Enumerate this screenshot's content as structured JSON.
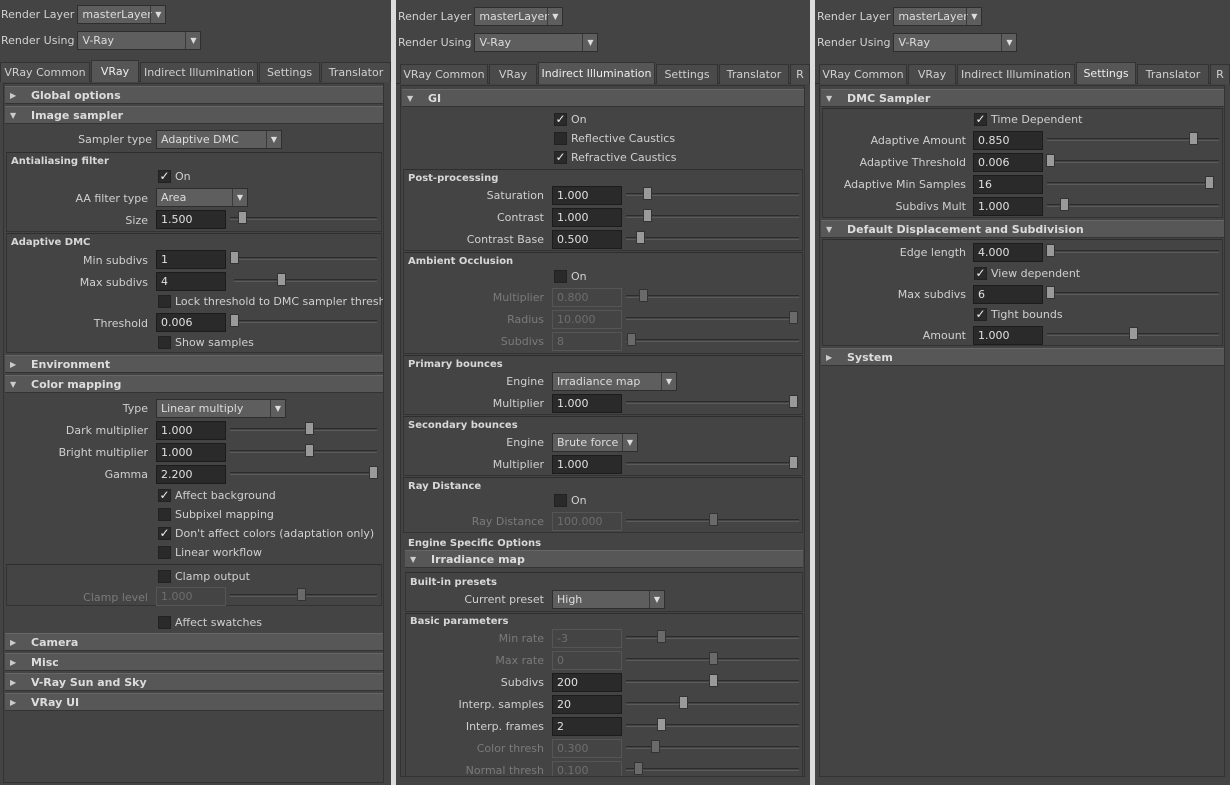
{
  "header": {
    "render_layer_label": "Render Layer",
    "render_layer_value": "masterLayer",
    "render_using_label": "Render Using",
    "render_using_value": "V-Ray"
  },
  "tabs": {
    "vray_common": "VRay Common",
    "vray": "VRay",
    "indirect": "Indirect Illumination",
    "settings": "Settings",
    "translator": "Translator",
    "r": "R"
  },
  "p1": {
    "global_options": "Global options",
    "image_sampler": "Image sampler",
    "sampler_type_label": "Sampler type",
    "sampler_type_value": "Adaptive DMC",
    "aa_filter": "Antialiasing filter",
    "aa_on": "On",
    "aa_filter_type_label": "AA filter type",
    "aa_filter_type_value": "Area",
    "size_label": "Size",
    "size_value": "1.500",
    "size_level": 0.08,
    "adaptive_dmc": "Adaptive DMC",
    "min_subdivs_label": "Min subdivs",
    "min_subdivs_value": "1",
    "min_subdivs_level": 0.0,
    "max_subdivs_label": "Max subdivs",
    "max_subdivs_value": "4",
    "max_subdivs_level": 0.33,
    "lock_threshold": "Lock threshold to DMC sampler threshold",
    "threshold_label": "Threshold",
    "threshold_value": "0.006",
    "threshold_level": 0.0,
    "show_samples": "Show samples",
    "environment": "Environment",
    "color_mapping": "Color mapping",
    "type_label": "Type",
    "type_value": "Linear multiply",
    "dark_mult_label": "Dark multiplier",
    "dark_mult_value": "1.000",
    "dark_mult_level": 0.54,
    "bright_mult_label": "Bright multiplier",
    "bright_mult_value": "1.000",
    "bright_mult_level": 0.54,
    "gamma_label": "Gamma",
    "gamma_value": "2.200",
    "gamma_level": 0.97,
    "affect_background": "Affect background",
    "subpixel_mapping": "Subpixel mapping",
    "dont_affect": "Don't affect colors (adaptation only)",
    "linear_workflow": "Linear workflow",
    "clamp_output": "Clamp output",
    "clamp_level_label": "Clamp level",
    "clamp_level_value": "1.000",
    "clamp_level_level": 0.48,
    "affect_swatches": "Affect swatches",
    "camera": "Camera",
    "misc": "Misc",
    "sunsky": "V-Ray Sun and Sky",
    "vrayui": "VRay UI"
  },
  "p2": {
    "gi": "GI",
    "on": "On",
    "reflective": "Reflective Caustics",
    "refractive": "Refractive Caustics",
    "post": "Post-processing",
    "saturation_label": "Saturation",
    "saturation_value": "1.000",
    "saturation_level": 0.12,
    "contrast_label": "Contrast",
    "contrast_value": "1.000",
    "contrast_level": 0.12,
    "contrast_base_label": "Contrast Base",
    "contrast_base_value": "0.500",
    "contrast_base_level": 0.08,
    "ao": "Ambient Occlusion",
    "ao_on": "On",
    "ao_mult_label": "Multiplier",
    "ao_mult_value": "0.800",
    "ao_mult_level": 0.1,
    "ao_radius_label": "Radius",
    "ao_radius_value": "10.000",
    "ao_radius_level": 1.0,
    "ao_subdivs_label": "Subdivs",
    "ao_subdivs_value": "8",
    "ao_subdivs_level": 0.03,
    "primary": "Primary bounces",
    "engine_label": "Engine",
    "primary_engine": "Irradiance map",
    "mult_label": "Multiplier",
    "primary_mult_value": "1.000",
    "primary_mult_level": 1.0,
    "secondary": "Secondary bounces",
    "secondary_engine": "Brute force",
    "secondary_mult_value": "1.000",
    "secondary_mult_level": 1.0,
    "ray_distance": "Ray Distance",
    "rd_on": "On",
    "rd_label": "Ray Distance",
    "rd_value": "100.000",
    "rd_level": 0.5,
    "engine_specific": "Engine Specific Options",
    "irradiance_map": "Irradiance map",
    "built_in": "Built-in presets",
    "current_preset_label": "Current preset",
    "current_preset_value": "High",
    "basic": "Basic parameters",
    "min_rate_label": "Min rate",
    "min_rate_value": "-3",
    "min_rate_level": 0.2,
    "max_rate_label": "Max rate",
    "max_rate_value": "0",
    "max_rate_level": 0.5,
    "subdivs_label": "Subdivs",
    "subdivs_value": "200",
    "subdivs_level": 0.5,
    "interp_samples_label": "Interp. samples",
    "interp_samples_value": "20",
    "interp_samples_level": 0.33,
    "interp_frames_label": "Interp. frames",
    "interp_frames_value": "2",
    "interp_frames_level": 0.2,
    "color_thresh_label": "Color thresh",
    "color_thresh_value": "0.300",
    "color_thresh_level": 0.17,
    "normal_thresh_label": "Normal thresh",
    "normal_thresh_value": "0.100",
    "normal_thresh_level": 0.07
  },
  "p3": {
    "dmc": "DMC Sampler",
    "time_dep": "Time Dependent",
    "adaptive_amount_label": "Adaptive Amount",
    "adaptive_amount_value": "0.850",
    "adaptive_amount_level": 0.85,
    "adaptive_threshold_label": "Adaptive Threshold",
    "adaptive_threshold_value": "0.006",
    "adaptive_threshold_level": 0.0,
    "adaptive_min_label": "Adaptive Min Samples",
    "adaptive_min_value": "16",
    "adaptive_min_level": 1.0,
    "subdivs_mult_label": "Subdivs Mult",
    "subdivs_mult_value": "1.000",
    "subdivs_mult_level": 0.1,
    "default_disp": "Default Displacement and Subdivision",
    "edge_length_label": "Edge length",
    "edge_length_value": "4.000",
    "edge_length_level": 0.0,
    "view_dependent": "View dependent",
    "max_subdivs_label": "Max subdivs",
    "max_subdivs_value": "6",
    "max_subdivs_level": 0.0,
    "tight_bounds": "Tight bounds",
    "amount_label": "Amount",
    "amount_value": "1.000",
    "amount_level": 0.5,
    "system": "System"
  },
  "colors": {
    "background": "#444444",
    "field": "#2a2a2a",
    "section": "#575757",
    "separator": "#dcdcdc"
  }
}
